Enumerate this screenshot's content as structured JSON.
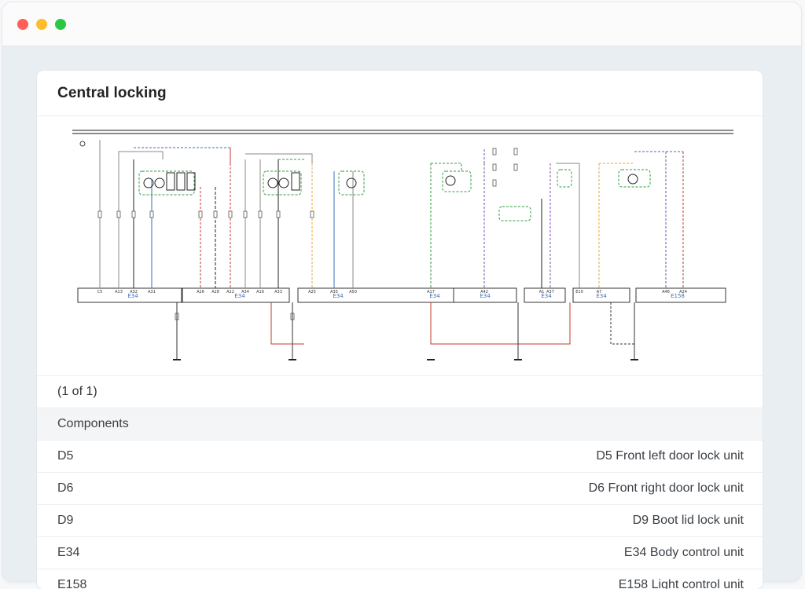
{
  "window": {
    "controls": [
      "close",
      "minimize",
      "zoom"
    ]
  },
  "card": {
    "title": "Central locking",
    "pager": "(1 of 1)",
    "section_header": "Components"
  },
  "diagram": {
    "connector_labels": [
      "E34",
      "E34",
      "E34",
      "E34",
      "E34",
      "E34",
      "E34",
      "E158"
    ],
    "pin_labels": [
      "C5",
      "A13",
      "A32",
      "A31",
      "A26",
      "A28",
      "A22",
      "A34",
      "A16",
      "A33",
      "A25",
      "A35",
      "A50",
      "A17",
      "A42",
      "A1",
      "A37",
      "E10",
      "A7",
      "A46",
      "A24"
    ],
    "colors": {
      "red": "#c0392b",
      "gray": "#8a8a8a",
      "green": "#2e9e3a",
      "blue": "#3d6ebf",
      "orange": "#f2a33a",
      "purple": "#7a4fb5",
      "black": "#222222"
    }
  },
  "components": [
    {
      "code": "D5",
      "desc": "D5 Front left door lock unit"
    },
    {
      "code": "D6",
      "desc": "D6 Front right door lock unit"
    },
    {
      "code": "D9",
      "desc": "D9 Boot lid lock unit"
    },
    {
      "code": "E34",
      "desc": "E34 Body control unit"
    },
    {
      "code": "E158",
      "desc": "E158 Light control unit"
    }
  ]
}
